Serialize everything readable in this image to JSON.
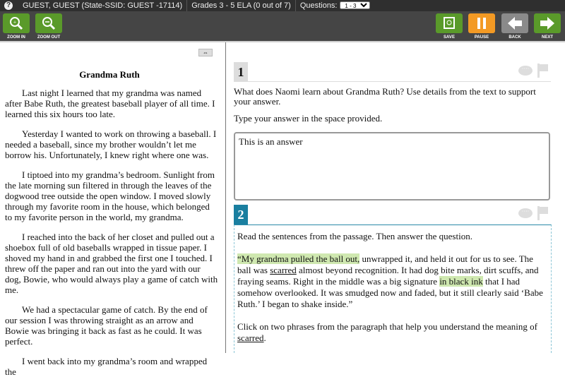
{
  "topbar": {
    "user": "GUEST, GUEST (State-SSID: GUEST -17114)",
    "test": "Grades 3 - 5 ELA (0 out of 7)",
    "questions_label": "Questions:",
    "questions_value": "1 - 3"
  },
  "toolbar": {
    "zoom_in": "ZOOM IN",
    "zoom_out": "ZOOM OUT",
    "save": "SAVE",
    "pause": "PAUSE",
    "back": "BACK",
    "next": "NEXT"
  },
  "colors": {
    "green": "#5a9a2a",
    "orange": "#f39a24",
    "q2": "#1a7fa0"
  },
  "passage": {
    "title": "Grandma Ruth",
    "paragraphs": [
      "Last night I learned that my grandma was named after Babe Ruth, the greatest baseball player of all time. I learned this six hours too late.",
      "Yesterday I wanted to work on throwing a baseball. I needed a baseball, since my brother wouldn’t let me borrow his. Unfortunately, I knew right where one was.",
      "I tiptoed into my grandma’s bedroom. Sunlight from the late morning sun filtered in through the leaves of the dogwood tree outside the open window. I moved slowly through my favorite room in the house, which belonged to my favorite person in the world, my grandma.",
      "I reached into the back of her closet and pulled out a shoebox full of old baseballs wrapped in tissue paper. I shoved my hand in and grabbed the first one I touched. I threw off the paper and ran out into the yard with our dog, Bowie, who would always play a game of catch with me.",
      "We had a spectacular game of catch. By the end of our session I was throwing straight as an arrow and Bowie was bringing it back as fast as he could. It was perfect.",
      "I went back into my grandma’s room and wrapped the"
    ]
  },
  "q1": {
    "number": "1",
    "prompt": "What does Naomi learn about Grandma Ruth? Use details from the text to support your answer.",
    "instruction": "Type your answer in the space provided.",
    "answer": "This is an answer"
  },
  "q2": {
    "number": "2",
    "intro": "Read the sentences from the passage. Then answer the question.",
    "p": {
      "a": "“My grandma pulled the ball out,",
      "b": " unwrapped it, and held it out for us to see. The ball was ",
      "c": "scarred",
      "d": " almost beyond recognition. It had dog bite marks, dirt scuffs, and fraying seams. Right in the middle was a big signature ",
      "e": "in black ink",
      "f": " that I had somehow overlooked. It was smudged now and faded, but it still clearly said ‘Babe Ruth.’ I began to shake inside.”"
    },
    "question": "Click on two phrases from the paragraph that help you understand the meaning of ",
    "word": "scarred",
    "end": "."
  }
}
